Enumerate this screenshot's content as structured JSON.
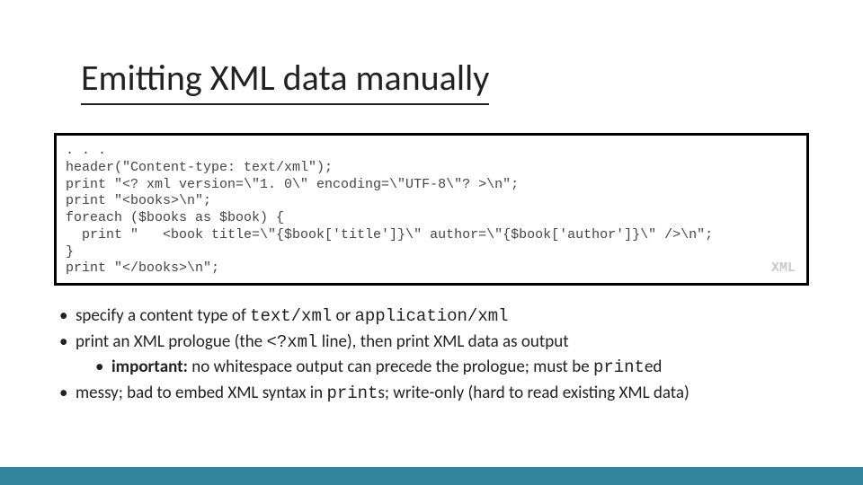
{
  "title": "Emitting XML data manually",
  "code": {
    "ellipsis": ". . .",
    "l1": "header(\"Content-type: text/xml\");",
    "l2": "print \"<? xml version=\\\"1. 0\\\" encoding=\\\"UTF-8\\\"? >\\n\";",
    "l3": "print \"<books>\\n\";",
    "l4": "foreach ($books as $book) {",
    "l5": "  print \"   <book title=\\\"{$book['title']}\\\" author=\\\"{$book['author']}\\\" />\\n\";",
    "l6": "}",
    "l7": "print \"</books>\\n\";",
    "tag": "XML"
  },
  "bullets": {
    "b1_pre": "specify a content type of ",
    "b1_c1": "text/xml",
    "b1_mid": " or ",
    "b1_c2": "application/xml",
    "b2_pre": "print an XML prologue (the ",
    "b2_c1": "<?xml",
    "b2_post": " line), then print XML data as output",
    "b2a_bold": "important:",
    "b2a_text": " no whitespace output can precede the prologue; must be ",
    "b2a_code": "print",
    "b2a_suffix": "ed",
    "b3_pre": "messy; bad to embed XML syntax in ",
    "b3_code": "print",
    "b3_post": "s; write-only (hard to read existing XML data)"
  }
}
